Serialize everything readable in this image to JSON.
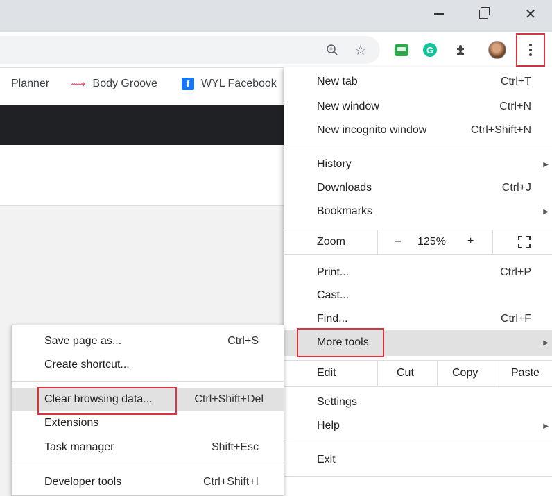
{
  "bookmarks": {
    "items": [
      {
        "label": "Planner"
      },
      {
        "label": "Body Groove"
      },
      {
        "label": "WYL Facebook"
      }
    ]
  },
  "menu": {
    "new_tab": {
      "label": "New tab",
      "shortcut": "Ctrl+T"
    },
    "new_window": {
      "label": "New window",
      "shortcut": "Ctrl+N"
    },
    "new_incognito": {
      "label": "New incognito window",
      "shortcut": "Ctrl+Shift+N"
    },
    "history": {
      "label": "History"
    },
    "downloads": {
      "label": "Downloads",
      "shortcut": "Ctrl+J"
    },
    "bookmarks": {
      "label": "Bookmarks"
    },
    "zoom": {
      "label": "Zoom",
      "minus": "–",
      "value": "125%",
      "plus": "+"
    },
    "print": {
      "label": "Print...",
      "shortcut": "Ctrl+P"
    },
    "cast": {
      "label": "Cast..."
    },
    "find": {
      "label": "Find...",
      "shortcut": "Ctrl+F"
    },
    "more_tools": {
      "label": "More tools"
    },
    "edit": {
      "label": "Edit",
      "cut": "Cut",
      "copy": "Copy",
      "paste": "Paste"
    },
    "settings": {
      "label": "Settings"
    },
    "help": {
      "label": "Help"
    },
    "exit": {
      "label": "Exit"
    }
  },
  "submenu": {
    "save_page": {
      "label": "Save page as...",
      "shortcut": "Ctrl+S"
    },
    "create_shortcut": {
      "label": "Create shortcut..."
    },
    "clear_data": {
      "label": "Clear browsing data...",
      "shortcut": "Ctrl+Shift+Del"
    },
    "extensions": {
      "label": "Extensions"
    },
    "task_manager": {
      "label": "Task manager",
      "shortcut": "Shift+Esc"
    },
    "dev_tools": {
      "label": "Developer tools",
      "shortcut": "Ctrl+Shift+I"
    }
  },
  "colors": {
    "highlight_border": "#d9333f",
    "hover_row": "#e1e1e1",
    "titlebar": "#dee1e6"
  }
}
